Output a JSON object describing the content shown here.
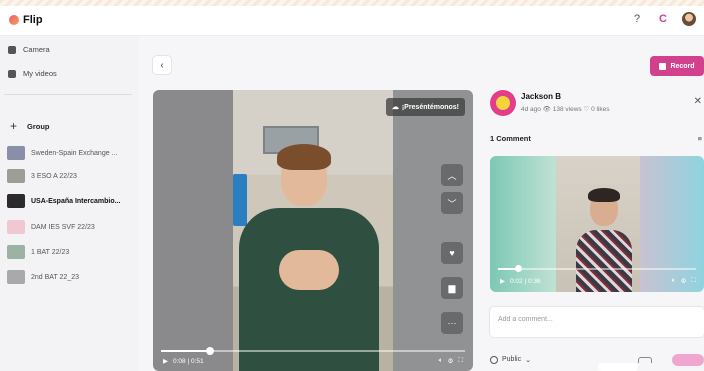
{
  "app": {
    "name": "Flip"
  },
  "topbar": {
    "help_icon": "?",
    "notifications_icon": "C"
  },
  "sidebar": {
    "nav": [
      {
        "label": "Camera",
        "icon": "camera-icon"
      },
      {
        "label": "My videos",
        "icon": "video-icon"
      }
    ],
    "group_header": "Group",
    "groups": [
      {
        "label": "Sweden-Spain Exchange ...",
        "active": false,
        "color": "#8a8ea8"
      },
      {
        "label": "3 ESO A 22/23",
        "active": false,
        "color": "#9a9f94"
      },
      {
        "label": "USA-España Intercambio...",
        "active": true,
        "color": "#2d2a2e"
      },
      {
        "label": "DAM IES SVF 22/23",
        "active": false,
        "color": "#f1c7d2"
      },
      {
        "label": "1 BAT 22/23",
        "active": false,
        "color": "#9ab3a2"
      },
      {
        "label": "2nd BAT 22_23",
        "active": false,
        "color": "#a9a9a9"
      }
    ]
  },
  "main": {
    "record_label": "Record",
    "video": {
      "tag": "¡Preséntémonos!",
      "time": "0:08 | 0:51",
      "progress": 0.16
    },
    "author": {
      "name": "Jackson B",
      "meta": "4d ago  👁 138 views  ♡ 0 likes"
    },
    "comments_count": "1 Comment",
    "comment_video": {
      "time": "0:02 | 0:36",
      "progress": 0.1
    },
    "add_comment_placeholder": "Add a comment...",
    "visibility": "Public"
  }
}
